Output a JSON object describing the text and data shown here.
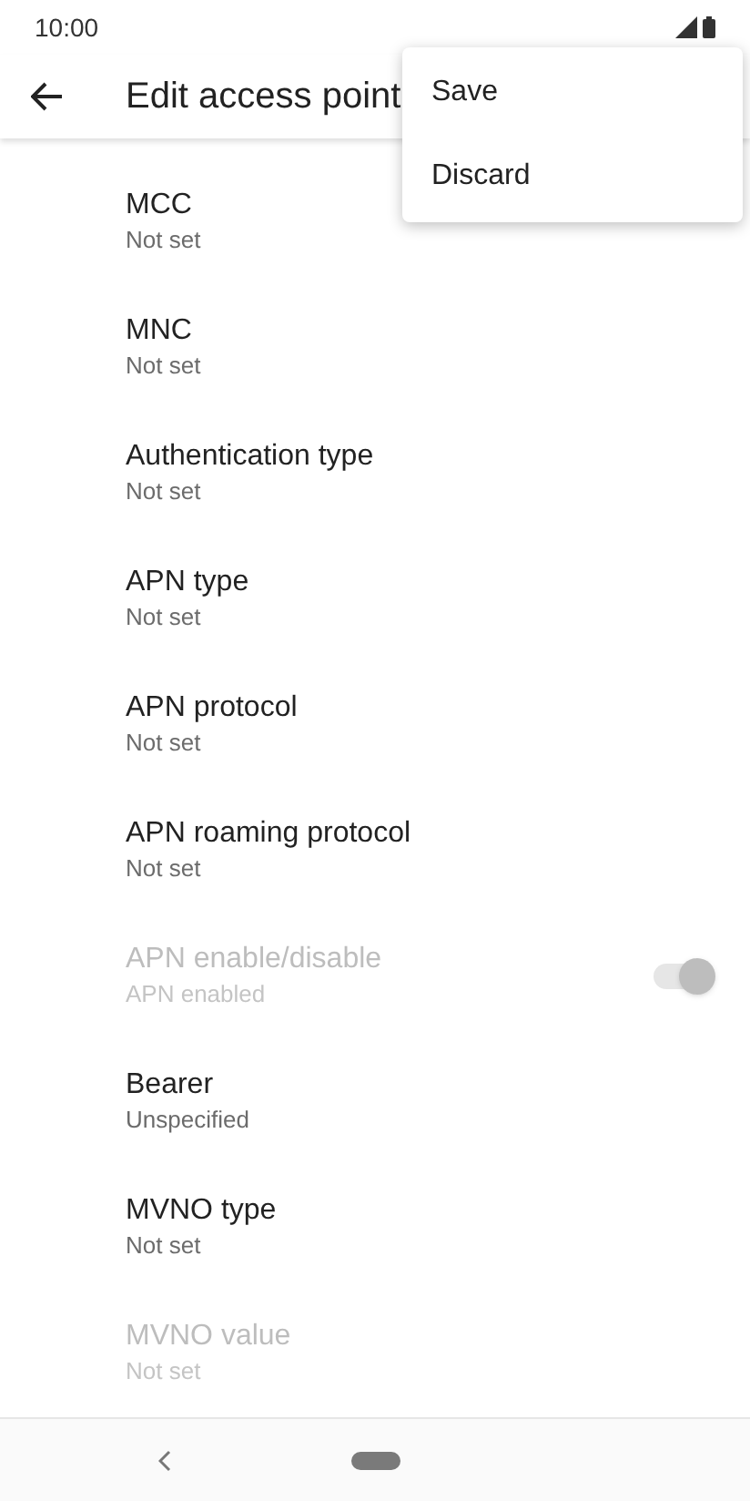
{
  "status_bar": {
    "time": "10:00"
  },
  "app_bar": {
    "title": "Edit access point"
  },
  "menu": {
    "items": [
      "Save",
      "Discard"
    ]
  },
  "settings": [
    {
      "kind": "text",
      "title": "MCC",
      "summary": "Not set",
      "disabled": false
    },
    {
      "kind": "text",
      "title": "MNC",
      "summary": "Not set",
      "disabled": false
    },
    {
      "kind": "text",
      "title": "Authentication type",
      "summary": "Not set",
      "disabled": false
    },
    {
      "kind": "text",
      "title": "APN type",
      "summary": "Not set",
      "disabled": false
    },
    {
      "kind": "text",
      "title": "APN protocol",
      "summary": "Not set",
      "disabled": false
    },
    {
      "kind": "text",
      "title": "APN roaming protocol",
      "summary": "Not set",
      "disabled": false
    },
    {
      "kind": "switch",
      "title": "APN enable/disable",
      "summary": "APN enabled",
      "disabled": true,
      "on": true
    },
    {
      "kind": "text",
      "title": "Bearer",
      "summary": "Unspecified",
      "disabled": false
    },
    {
      "kind": "text",
      "title": "MVNO type",
      "summary": "Not set",
      "disabled": false
    },
    {
      "kind": "text",
      "title": "MVNO value",
      "summary": "Not set",
      "disabled": true
    }
  ]
}
